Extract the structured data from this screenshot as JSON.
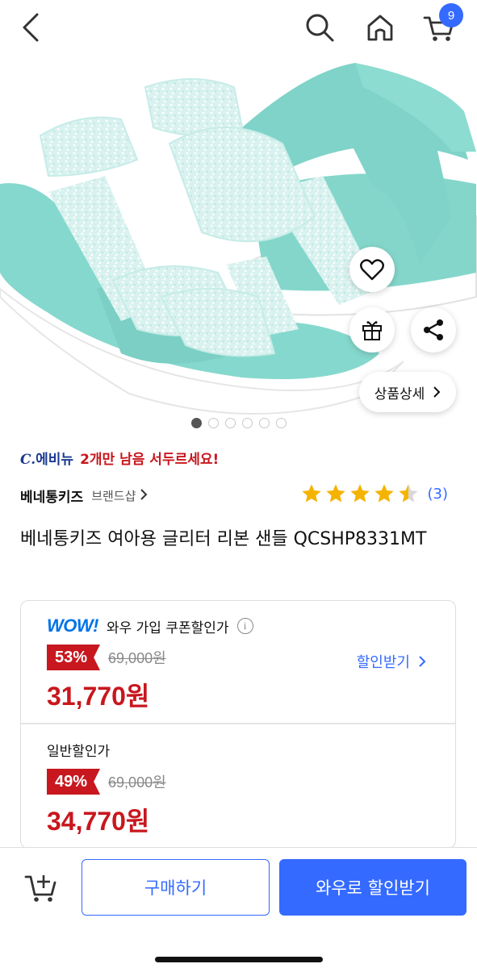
{
  "nav": {
    "cart_count": "9"
  },
  "gallery": {
    "detail_label": "상품상세",
    "page_count": 6,
    "active_index": 0
  },
  "urgency": {
    "brand_logo": "C.",
    "brand_name": "에비뉴",
    "message": "2개만 남음 서두르세요!"
  },
  "brand": {
    "name": "베네통키즈",
    "shop_label": "브랜드샵"
  },
  "rating": {
    "stars": 4.5,
    "count": "(3)"
  },
  "product": {
    "title": "베네통키즈 여아용 글리터 리본 샌들 QCSHP8331MT"
  },
  "price": {
    "wow": {
      "logo": "WOW!",
      "label": "와우 가입 쿠폰할인가",
      "discount": "53%",
      "original": "69,000원",
      "sale": "31,770원",
      "coupon_link": "할인받기"
    },
    "normal": {
      "label": "일반할인가",
      "discount": "49%",
      "original": "69,000원",
      "sale": "34,770원"
    }
  },
  "bottom": {
    "buy_label": "구매하기",
    "wow_buy_label": "와우로 할인받기"
  },
  "colors": {
    "accent": "#346aff",
    "sale_red": "#c8171e",
    "wow_blue": "#0073e9",
    "star": "#f5b301"
  }
}
